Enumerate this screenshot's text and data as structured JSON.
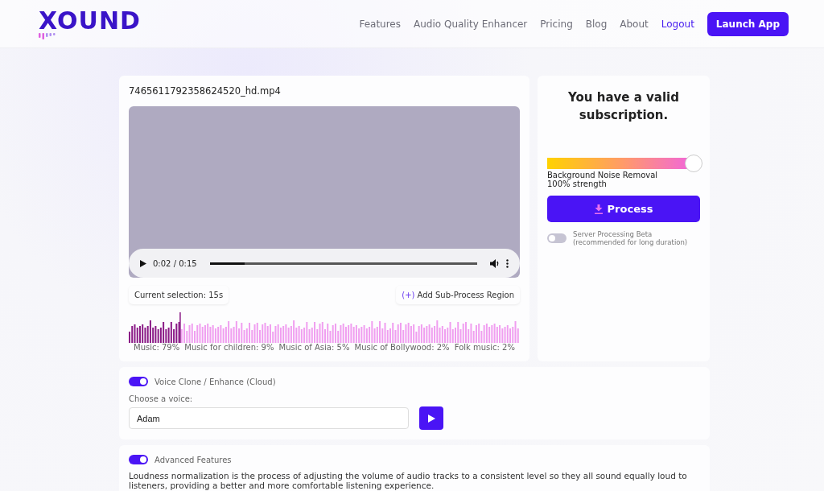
{
  "header": {
    "logo": "XOUND",
    "nav": [
      {
        "label": "Features",
        "kind": "link"
      },
      {
        "label": "Audio Quality Enhancer",
        "kind": "link"
      },
      {
        "label": "Pricing",
        "kind": "link"
      },
      {
        "label": "Blog",
        "kind": "link"
      },
      {
        "label": "About",
        "kind": "link"
      },
      {
        "label": "Logout",
        "kind": "accent"
      },
      {
        "label": "Launch App",
        "kind": "button"
      }
    ]
  },
  "media": {
    "filename": "7465611792358624520_hd.mp4",
    "time": "0:02 / 0:15",
    "level": 0.13,
    "selection": "Current selection: 15s",
    "add_region_icon": "(+)",
    "add_region": "Add Sub-Process Region",
    "tags": [
      "Music: 79%",
      "Music for children: 9%",
      "Music of Asia: 5%",
      "Music of Bollywood: 2%",
      "Folk music: 2%"
    ]
  },
  "subscription": {
    "title": "You have a valid subscription.",
    "slider": {
      "level": 1.0,
      "label": "Background Noise Removal",
      "reading": "100% strength"
    },
    "process": "Process",
    "server": {
      "on": false,
      "label": "Server Processing Beta",
      "note": "(recommended for long duration)"
    }
  },
  "voice": {
    "on": true,
    "label": "Voice Clone / Enhance (Cloud)",
    "field_label": "Choose a voice:",
    "value": "Adam"
  },
  "advanced": {
    "on": true,
    "label": "Advanced Features",
    "text": "Loudness normalization is the process of adjusting the volume of audio tracks to a consistent level so they all sound equally loud to listeners, providing a better and more comfortable listening experience."
  }
}
